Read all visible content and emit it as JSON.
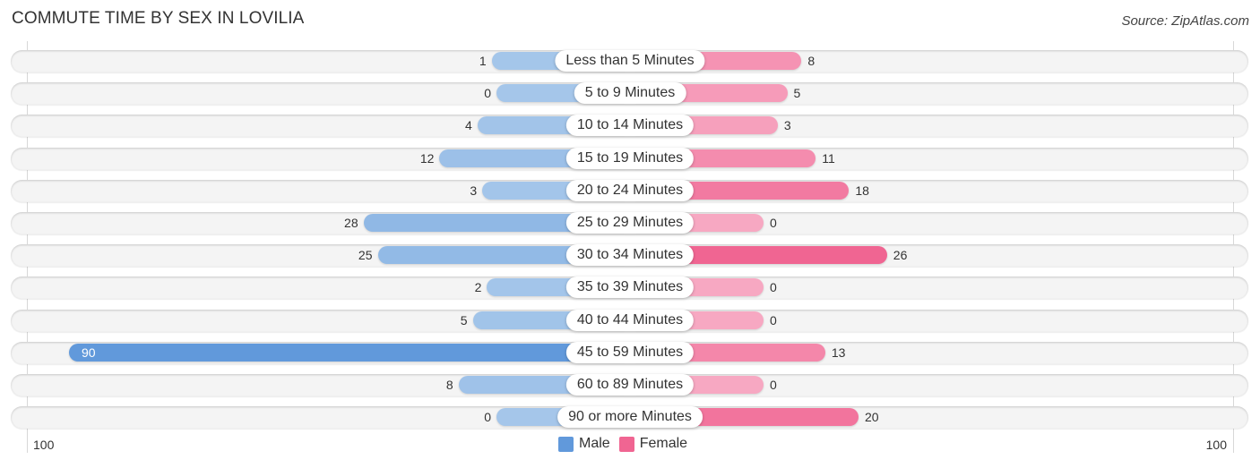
{
  "title": "COMMUTE TIME BY SEX IN LOVILIA",
  "source": "Source: ZipAtlas.com",
  "colors": {
    "male": "#6199db",
    "male_light": "#a5c6ea",
    "female": "#f06592",
    "female_light": "#f7a8c2"
  },
  "chart_data": {
    "type": "bar",
    "orientation": "horizontal-diverging",
    "title": "COMMUTE TIME BY SEX IN LOVILIA",
    "categories": [
      "Less than 5 Minutes",
      "5 to 9 Minutes",
      "10 to 14 Minutes",
      "15 to 19 Minutes",
      "20 to 24 Minutes",
      "25 to 29 Minutes",
      "30 to 34 Minutes",
      "35 to 39 Minutes",
      "40 to 44 Minutes",
      "45 to 59 Minutes",
      "60 to 89 Minutes",
      "90 or more Minutes"
    ],
    "series": [
      {
        "name": "Male",
        "values": [
          1,
          0,
          4,
          12,
          3,
          28,
          25,
          2,
          5,
          90,
          8,
          0
        ]
      },
      {
        "name": "Female",
        "values": [
          8,
          5,
          3,
          11,
          18,
          0,
          26,
          0,
          0,
          13,
          0,
          20
        ]
      }
    ],
    "axis": {
      "left_label": "100",
      "right_label": "100",
      "range": [
        0,
        100
      ]
    },
    "legend": {
      "position": "bottom-center",
      "entries": [
        "Male",
        "Female"
      ]
    }
  }
}
